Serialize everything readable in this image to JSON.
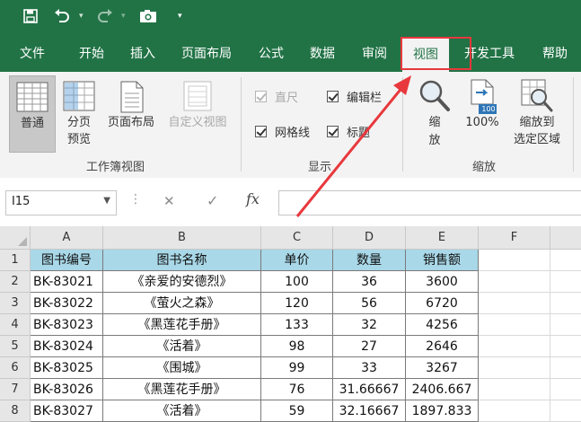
{
  "quick_access": {
    "save": "save-icon",
    "undo": "undo-icon",
    "redo": "redo-icon",
    "camera": "camera-icon",
    "customize": "▾"
  },
  "tabs": [
    "文件",
    "开始",
    "插入",
    "页面布局",
    "公式",
    "数据",
    "审阅",
    "视图",
    "开发工具",
    "帮助"
  ],
  "active_tab": "视图",
  "ribbon": {
    "workbook_views": {
      "group_label": "工作簿视图",
      "normal": "普通",
      "page_break_line1": "分页",
      "page_break_line2": "预览",
      "page_layout": "页面布局",
      "custom_views": "自定义视图"
    },
    "show": {
      "group_label": "显示",
      "ruler": "直尺",
      "formula_bar": "编辑栏",
      "gridlines": "网格线",
      "headings": "标题"
    },
    "zoom": {
      "group_label": "缩放",
      "zoom_line1": "缩",
      "zoom_line2": "放",
      "hundred_icon_text": "100",
      "hundred": "100%",
      "zoom_selection_line1": "缩放到",
      "zoom_selection_line2": "选定区域"
    }
  },
  "formula_bar": {
    "name_box": "I15",
    "cancel": "✕",
    "enter": "✓",
    "fx": "fx",
    "value": ""
  },
  "columns": [
    "A",
    "B",
    "C",
    "D",
    "E",
    "F"
  ],
  "rows": [
    "1",
    "2",
    "3",
    "4",
    "5",
    "6",
    "7",
    "8"
  ],
  "table": {
    "headers": [
      "图书编号",
      "图书名称",
      "单价",
      "数量",
      "销售额"
    ],
    "rows": [
      [
        "BK-83021",
        "《亲爱的安德烈》",
        "100",
        "36",
        "3600"
      ],
      [
        "BK-83022",
        "《萤火之森》",
        "120",
        "56",
        "6720"
      ],
      [
        "BK-83023",
        "《黑莲花手册》",
        "133",
        "32",
        "4256"
      ],
      [
        "BK-83024",
        "《活着》",
        "98",
        "27",
        "2646"
      ],
      [
        "BK-83025",
        "《围城》",
        "99",
        "33",
        "3267"
      ],
      [
        "BK-83026",
        "《黑莲花手册》",
        "76",
        "31.66667",
        "2406.667"
      ],
      [
        "BK-83027",
        "《活着》",
        "59",
        "32.16667",
        "1897.833"
      ]
    ]
  },
  "colors": {
    "brand_green": "#217346",
    "header_fill": "#a9d8e8",
    "highlight_red": "#e8383d"
  }
}
